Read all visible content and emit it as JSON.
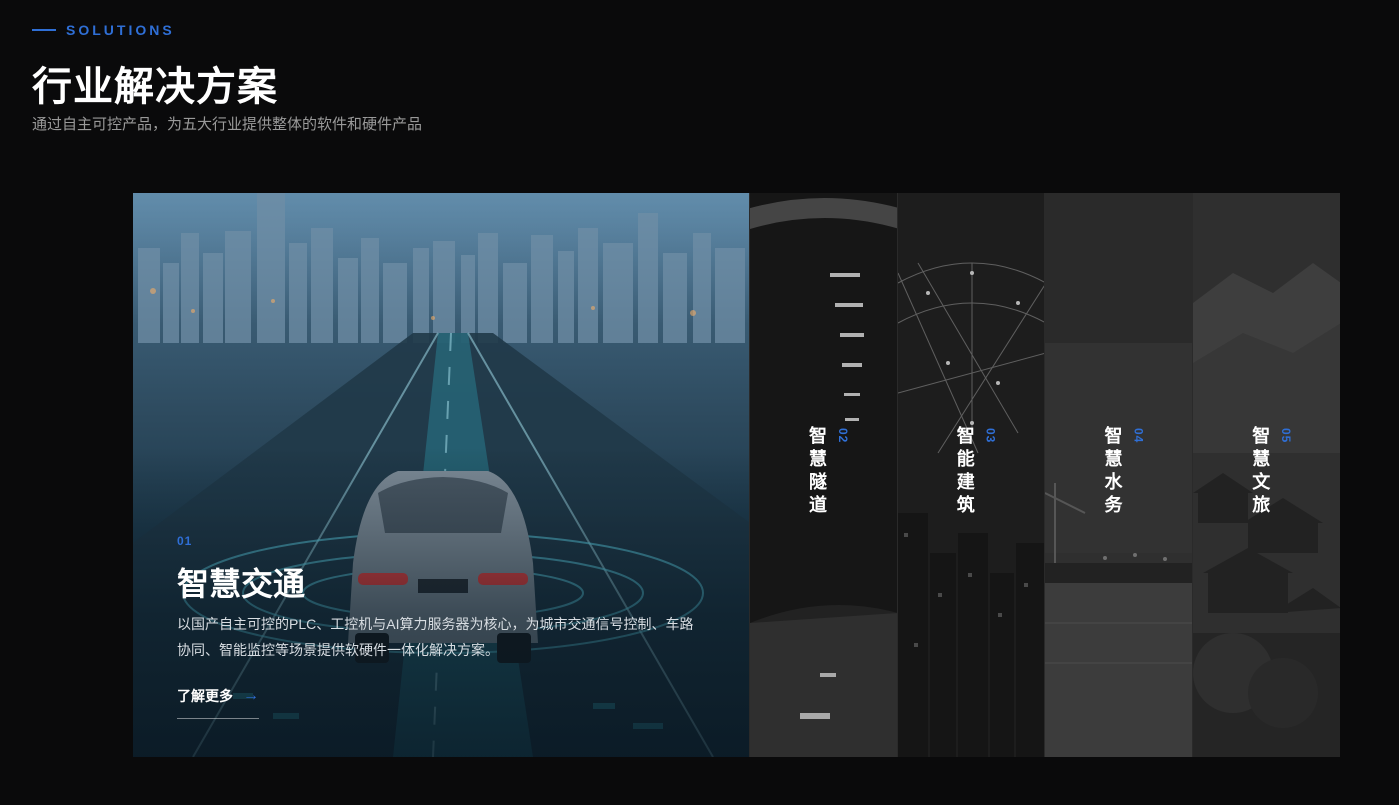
{
  "header": {
    "eyebrow": "SOLUTIONS",
    "title": "行业解决方案",
    "subtitle": "通过自主可控产品，为五大行业提供整体的软件和硬件产品"
  },
  "active_panel": {
    "number": "01",
    "title": "智慧交通",
    "description": "以国产自主可控的PLC、工控机与AI算力服务器为核心，为城市交通信号控制、车路协同、智能监控等场景提供软硬件一体化解决方案。",
    "link_label": "了解更多",
    "link_arrow": "→"
  },
  "panels": [
    {
      "number": "02",
      "title": "智慧隧道"
    },
    {
      "number": "03",
      "title": "智能建筑"
    },
    {
      "number": "04",
      "title": "智慧水务"
    },
    {
      "number": "05",
      "title": "智慧文旅"
    }
  ],
  "colors": {
    "accent": "#2f6fd6",
    "background": "#0a0a0b"
  }
}
